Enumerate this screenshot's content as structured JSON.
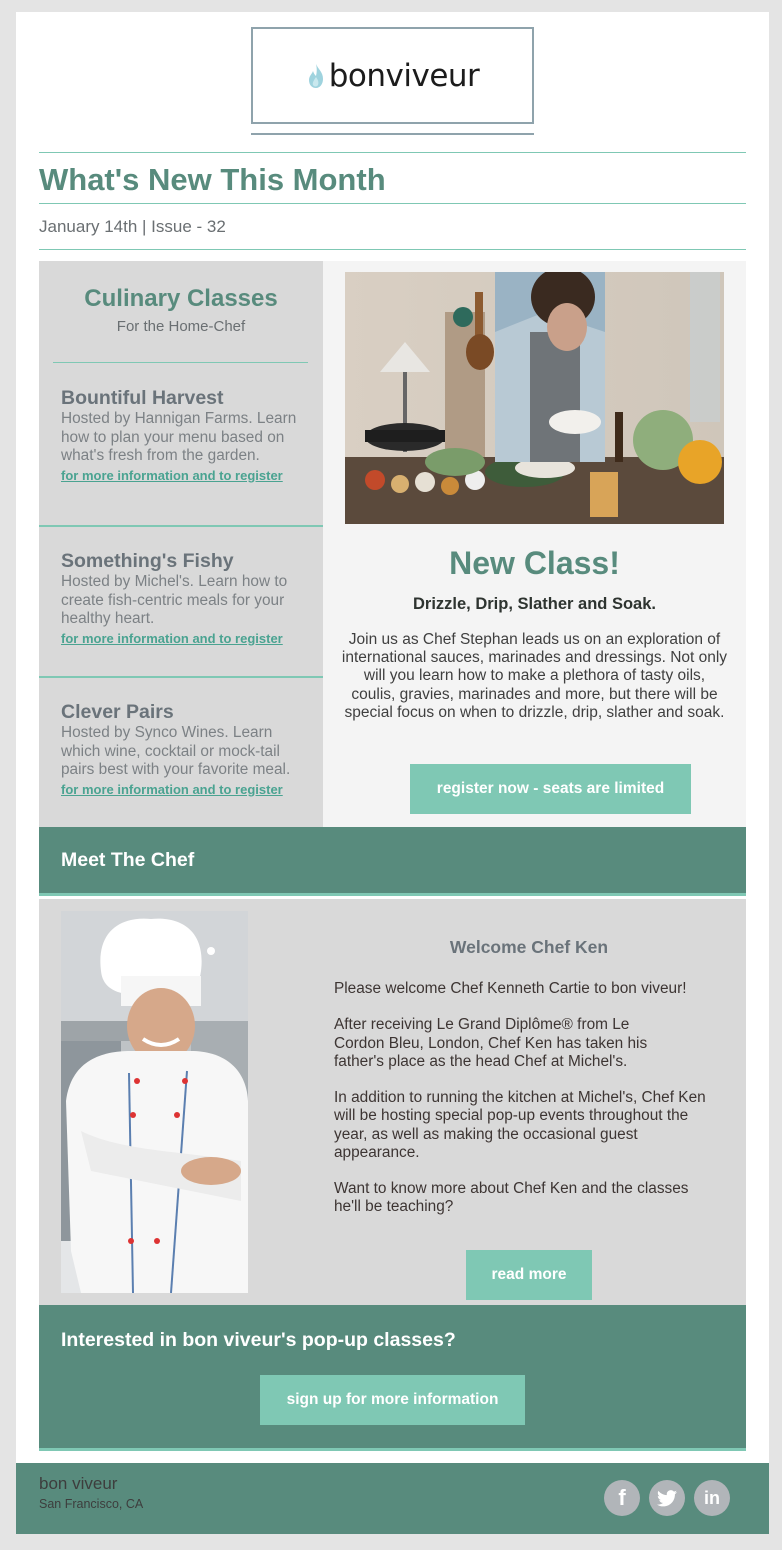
{
  "brand": {
    "logo_text": "bonviveur",
    "logo_icon": "flame-icon",
    "accent_color": "#588b7d",
    "button_color": "#7fc8b4",
    "divider_color": "#7fc8b4"
  },
  "header": {
    "title": "What's New This Month",
    "issue": "January 14th | Issue - 32"
  },
  "classes": {
    "title": "Culinary Classes",
    "subtitle": "For the Home-Chef",
    "items": [
      {
        "name": "Bountiful Harvest",
        "description": "Hosted by Hannigan Farms. Learn how to plan your menu based on what's fresh from the garden.",
        "link": "for more information and to register"
      },
      {
        "name": "Something's Fishy",
        "description": "Hosted by Michel's. Learn how to create fish-centric meals for your healthy heart.",
        "link": "for more information and to register"
      },
      {
        "name": "Clever Pairs",
        "description": "Hosted by Synco Wines. Learn which wine, cocktail or mock-tail pairs best with your favorite meal.",
        "link": "for more information and to register"
      }
    ]
  },
  "new_class": {
    "image_alt": "Chef cooking in kitchen",
    "title": "New Class!",
    "subtitle": "Drizzle, Drip, Slather and Soak.",
    "body": "Join us as Chef Stephan leads us on an exploration of international sauces, marinades and dressings. Not only will you learn how to make a plethora of tasty oils, coulis, gravies, marinades and more, but there will be special focus on when to drizzle, drip, slather and soak.",
    "button": "register now - seats are limited"
  },
  "meet_chef": {
    "section_title": "Meet The Chef",
    "image_alt": "Chef Ken portrait",
    "heading": "Welcome Chef Ken",
    "paragraphs": [
      "Please welcome Chef Kenneth Cartie to bon viveur!",
      "After receiving Le Grand Diplôme® from Le Cordon Bleu, London, Chef Ken has taken his father's place as the head Chef at Michel's.",
      "In addition to running the kitchen at Michel's, Chef Ken will be hosting special pop-up events throughout the year, as well as making the occasional guest appearance.",
      "Want to know more about Chef Ken and the classes he'll be teaching?"
    ],
    "button": "read more"
  },
  "popup": {
    "title": "Interested in bon viveur's pop-up classes?",
    "button": "sign up for more information"
  },
  "footer": {
    "company": "bon viveur",
    "location": "San Francisco, CA",
    "social": [
      {
        "name": "facebook-icon",
        "glyph": "f"
      },
      {
        "name": "twitter-icon",
        "glyph": ""
      },
      {
        "name": "linkedin-icon",
        "glyph": "in"
      }
    ]
  }
}
